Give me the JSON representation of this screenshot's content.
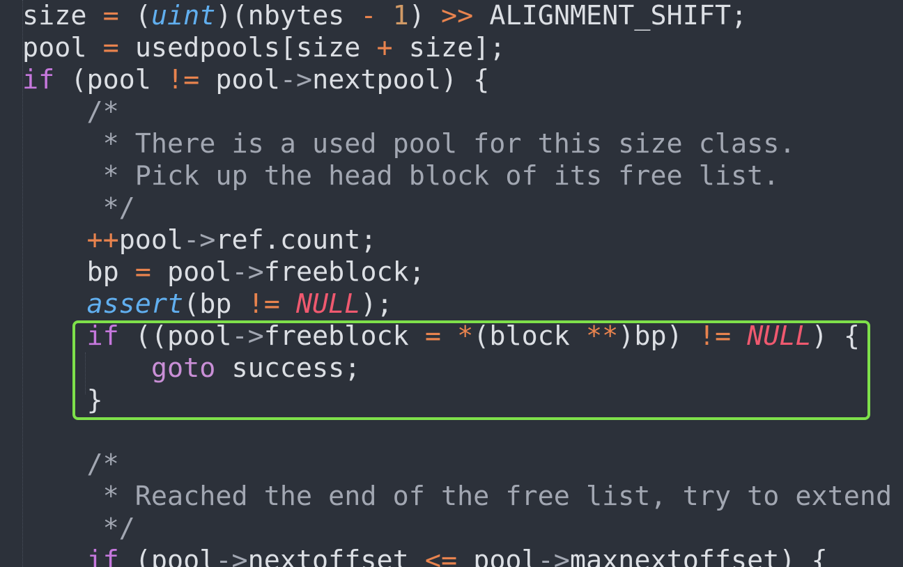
{
  "editor": {
    "lines": [
      {
        "tokens": [
          {
            "t": "size ",
            "c": ""
          },
          {
            "t": "=",
            "c": "op"
          },
          {
            "t": " (",
            "c": ""
          },
          {
            "t": "uint",
            "c": "type"
          },
          {
            "t": ")(nbytes ",
            "c": ""
          },
          {
            "t": "-",
            "c": "op"
          },
          {
            "t": " ",
            "c": ""
          },
          {
            "t": "1",
            "c": "num"
          },
          {
            "t": ") ",
            "c": ""
          },
          {
            "t": ">>",
            "c": "op"
          },
          {
            "t": " ALIGNMENT_SHIFT;",
            "c": ""
          }
        ]
      },
      {
        "tokens": [
          {
            "t": "pool ",
            "c": ""
          },
          {
            "t": "=",
            "c": "op"
          },
          {
            "t": " usedpools[size ",
            "c": ""
          },
          {
            "t": "+",
            "c": "op"
          },
          {
            "t": " size];",
            "c": ""
          }
        ]
      },
      {
        "tokens": [
          {
            "t": "if",
            "c": "kw-if"
          },
          {
            "t": " (pool ",
            "c": ""
          },
          {
            "t": "!=",
            "c": "op"
          },
          {
            "t": " pool",
            "c": ""
          },
          {
            "t": "->",
            "c": "cm"
          },
          {
            "t": "nextpool) {",
            "c": ""
          }
        ]
      },
      {
        "tokens": [
          {
            "t": "    /*",
            "c": "cm"
          }
        ]
      },
      {
        "tokens": [
          {
            "t": "     * There is a used pool for this size class.",
            "c": "cm"
          }
        ]
      },
      {
        "tokens": [
          {
            "t": "     * Pick up the head block of its free list.",
            "c": "cm"
          }
        ]
      },
      {
        "tokens": [
          {
            "t": "     */",
            "c": "cm"
          }
        ]
      },
      {
        "tokens": [
          {
            "t": "    ",
            "c": ""
          },
          {
            "t": "++",
            "c": "op"
          },
          {
            "t": "pool",
            "c": ""
          },
          {
            "t": "->",
            "c": "cm"
          },
          {
            "t": "ref.count;",
            "c": ""
          }
        ]
      },
      {
        "tokens": [
          {
            "t": "    bp ",
            "c": ""
          },
          {
            "t": "=",
            "c": "op"
          },
          {
            "t": " pool",
            "c": ""
          },
          {
            "t": "->",
            "c": "cm"
          },
          {
            "t": "freeblock;",
            "c": ""
          }
        ]
      },
      {
        "tokens": [
          {
            "t": "    ",
            "c": ""
          },
          {
            "t": "assert",
            "c": "fn"
          },
          {
            "t": "(bp ",
            "c": ""
          },
          {
            "t": "!=",
            "c": "op"
          },
          {
            "t": " ",
            "c": ""
          },
          {
            "t": "NULL",
            "c": "null"
          },
          {
            "t": ");",
            "c": ""
          }
        ]
      },
      {
        "tokens": [
          {
            "t": "    ",
            "c": ""
          },
          {
            "t": "if",
            "c": "kw-if"
          },
          {
            "t": " ((pool",
            "c": ""
          },
          {
            "t": "->",
            "c": "cm"
          },
          {
            "t": "freeblock ",
            "c": ""
          },
          {
            "t": "=",
            "c": "op"
          },
          {
            "t": " ",
            "c": ""
          },
          {
            "t": "*",
            "c": "op"
          },
          {
            "t": "(block ",
            "c": ""
          },
          {
            "t": "**",
            "c": "op"
          },
          {
            "t": ")bp) ",
            "c": ""
          },
          {
            "t": "!=",
            "c": "op"
          },
          {
            "t": " ",
            "c": ""
          },
          {
            "t": "NULL",
            "c": "null"
          },
          {
            "t": ") {",
            "c": ""
          }
        ]
      },
      {
        "tokens": [
          {
            "t": "        ",
            "c": ""
          },
          {
            "t": "goto",
            "c": "goto"
          },
          {
            "t": " success;",
            "c": ""
          }
        ]
      },
      {
        "tokens": [
          {
            "t": "    }",
            "c": ""
          }
        ]
      },
      {
        "tokens": [
          {
            "t": "",
            "c": ""
          }
        ]
      },
      {
        "tokens": [
          {
            "t": "    /*",
            "c": "cm"
          }
        ]
      },
      {
        "tokens": [
          {
            "t": "     * Reached the end of the free list, try to extend i",
            "c": "cm"
          }
        ]
      },
      {
        "tokens": [
          {
            "t": "     */",
            "c": "cm"
          }
        ]
      },
      {
        "tokens": [
          {
            "t": "    ",
            "c": ""
          },
          {
            "t": "if",
            "c": "kw-if"
          },
          {
            "t": " (pool",
            "c": ""
          },
          {
            "t": "->",
            "c": "cm"
          },
          {
            "t": "nextoffset ",
            "c": ""
          },
          {
            "t": "<=",
            "c": "op"
          },
          {
            "t": " pool",
            "c": ""
          },
          {
            "t": "->",
            "c": "cm"
          },
          {
            "t": "maxnextoffset) {",
            "c": ""
          }
        ]
      }
    ]
  },
  "highlight": {
    "label": "highlighted-goto-block",
    "color": "#7ee04a"
  }
}
